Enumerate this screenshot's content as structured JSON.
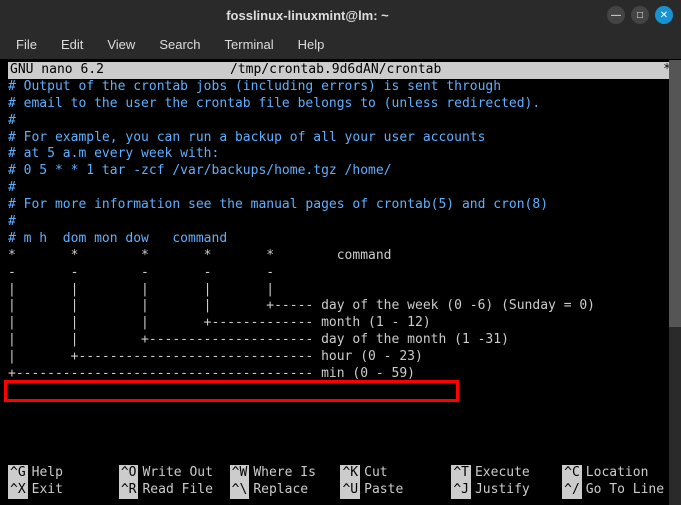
{
  "titlebar": {
    "title": "fosslinux-linuxmint@lm: ~"
  },
  "menubar": {
    "items": [
      "File",
      "Edit",
      "View",
      "Search",
      "Terminal",
      "Help"
    ]
  },
  "nano": {
    "app": " GNU nano 6.2",
    "filepath": "/tmp/crontab.9d6dAN/crontab ",
    "modified": "*"
  },
  "content": {
    "l0": "# Output of the crontab jobs (including errors) is sent through",
    "l1": "# email to the user the crontab file belongs to (unless redirected).",
    "l2": "#",
    "l3": "# For example, you can run a backup of all your user accounts",
    "l4": "# at 5 a.m every week with:",
    "l5": "# 0 5 * * 1 tar -zcf /var/backups/home.tgz /home/",
    "l6": "#",
    "l7": "# For more information see the manual pages of crontab(5) and cron(8)",
    "l8": "#",
    "l9": "# m h  dom mon dow   command",
    "l10": "",
    "l11": "*       *        *       *       *        command",
    "l12": "-       -        -       -       -",
    "l13": "|       |        |       |       |",
    "l14": "|       |        |       |       +----- day of the week (0 -6) (Sunday = 0)",
    "l15": "|       |        |       +------------- month (1 - 12)",
    "l16": "|       |        +--------------------- day of the month (1 -31)",
    "l17": "|       +------------------------------ hour (0 - 23)",
    "l18": "+-------------------------------------- min (0 - 59)"
  },
  "shortcuts": {
    "r1": [
      {
        "key": "^G",
        "label": "Help"
      },
      {
        "key": "^O",
        "label": "Write Out"
      },
      {
        "key": "^W",
        "label": "Where Is"
      },
      {
        "key": "^K",
        "label": "Cut"
      },
      {
        "key": "^T",
        "label": "Execute"
      },
      {
        "key": "^C",
        "label": "Location"
      }
    ],
    "r2": [
      {
        "key": "^X",
        "label": "Exit"
      },
      {
        "key": "^R",
        "label": "Read File"
      },
      {
        "key": "^\\",
        "label": "Replace"
      },
      {
        "key": "^U",
        "label": "Paste"
      },
      {
        "key": "^J",
        "label": "Justify"
      },
      {
        "key": "^/",
        "label": "Go To Line"
      }
    ]
  }
}
